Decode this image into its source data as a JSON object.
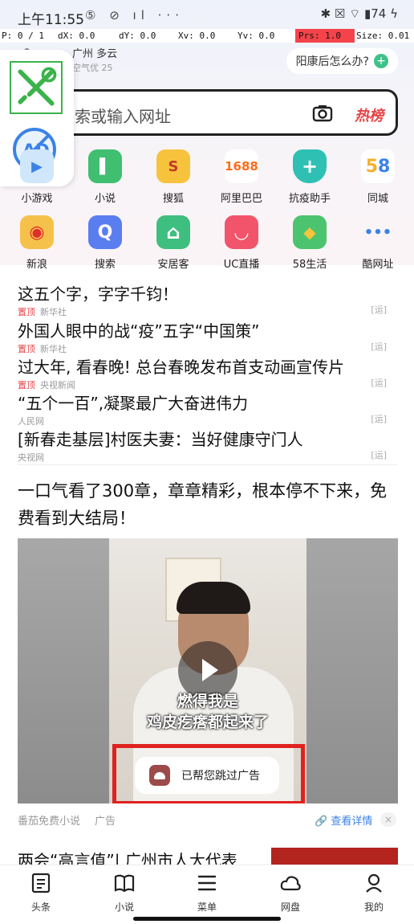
{
  "status_bar": {
    "time": "上午11:55",
    "icons_text": "⑤ ⊘ ıl ···",
    "right_text": "✱ ☒ ⌔ ▮74 ϟ"
  },
  "debug_bar": {
    "p": "P: 0 / 1",
    "dx": "dX: 0.0",
    "dy": "dY: 0.0",
    "xv": "Xv: 0.0",
    "yv": "Yv: 0.0",
    "prs": "Prs: 1.0",
    "size": "Size: 0.01"
  },
  "weather": {
    "city": "广州 多云",
    "air": "空气优 25"
  },
  "ask_button": {
    "label": "阳康后怎么办?"
  },
  "search": {
    "placeholder": "搜索或输入网址",
    "hot_label": "热榜"
  },
  "accent": {
    "red": "#e84347",
    "green": "#3fc28a",
    "blue": "#3b82e6"
  },
  "shortcuts_row1": [
    {
      "label": "小游戏",
      "icon": "game-icon",
      "color": "#7ec0f5",
      "glyph": "▶"
    },
    {
      "label": "小说",
      "icon": "book-icon",
      "color": "#3fbf6f",
      "glyph": "▌"
    },
    {
      "label": "搜狐",
      "icon": "sohu-icon",
      "color": "#f7c33c",
      "glyph": "S"
    },
    {
      "label": "阿里巴巴",
      "icon": "1688-icon",
      "color": "#ff7a2e",
      "glyph": "1688"
    },
    {
      "label": "抗疫助手",
      "icon": "shield-plus-icon",
      "color": "#2fc0b4",
      "glyph": "+"
    },
    {
      "label": "同城",
      "icon": "58-icon",
      "color": "#ffffff",
      "glyph": "58"
    }
  ],
  "shortcuts_row2": [
    {
      "label": "新浪",
      "icon": "sina-icon",
      "color": "#f6c14a",
      "glyph": "◉"
    },
    {
      "label": "搜索",
      "icon": "search-icon",
      "color": "#5a7ef0",
      "glyph": "Q"
    },
    {
      "label": "安居客",
      "icon": "house-icon",
      "color": "#3fbf7f",
      "glyph": "⌂"
    },
    {
      "label": "UC直播",
      "icon": "uc-live-icon",
      "color": "#f1546b",
      "glyph": "◡"
    },
    {
      "label": "58生活",
      "icon": "map-pin-icon",
      "color": "#4cc46f",
      "glyph": "◆"
    },
    {
      "label": "酷网址",
      "icon": "more-dots-icon",
      "color": "#ffffff",
      "glyph": "•••"
    }
  ],
  "news": [
    {
      "title": "这五个字，字字千钧！",
      "top": "",
      "source": "",
      "tag": "[运]"
    },
    {
      "title": "外国人眼中的战“疫”五字“中国策”",
      "top": "置顶",
      "source": "新华社",
      "tag": "[运]"
    },
    {
      "title": "过大年, 看春晚! 总台春晚发布首支动画宣传片",
      "top": "置顶",
      "source": "新华社",
      "tag": "[运]"
    },
    {
      "title": "“五个一百”,凝聚最广大奋进伟力",
      "top": "置顶",
      "source": "央视新闻",
      "tag": "[运]"
    },
    {
      "title": "[新春走基层]村医夫妻：当好健康守门人",
      "top": "",
      "source": "人民网",
      "tag": "[运]"
    },
    {
      "title": "",
      "top": "",
      "source": "央视网",
      "tag": "[运]"
    }
  ],
  "feed": {
    "title": "一口气看了300章，章章精彩，根本停不下来，免费看到大结局！",
    "caption_line1": "燃得我是",
    "caption_line2": "鸡皮疙瘩都起来了",
    "toast": "已帮您跳过广告",
    "source": "番茄免费小说",
    "ad_tag": "广告",
    "detail_link": "查看详情",
    "close": "×"
  },
  "next_item": {
    "title": "两会“高言值”| 广州市人大代表"
  },
  "bottom_nav": [
    {
      "label": "头条",
      "icon": "headline-icon"
    },
    {
      "label": "小说",
      "icon": "book-open-icon"
    },
    {
      "label": "菜单",
      "icon": "menu-icon"
    },
    {
      "label": "网盘",
      "icon": "cloud-icon"
    },
    {
      "label": "我的",
      "icon": "user-icon"
    }
  ]
}
